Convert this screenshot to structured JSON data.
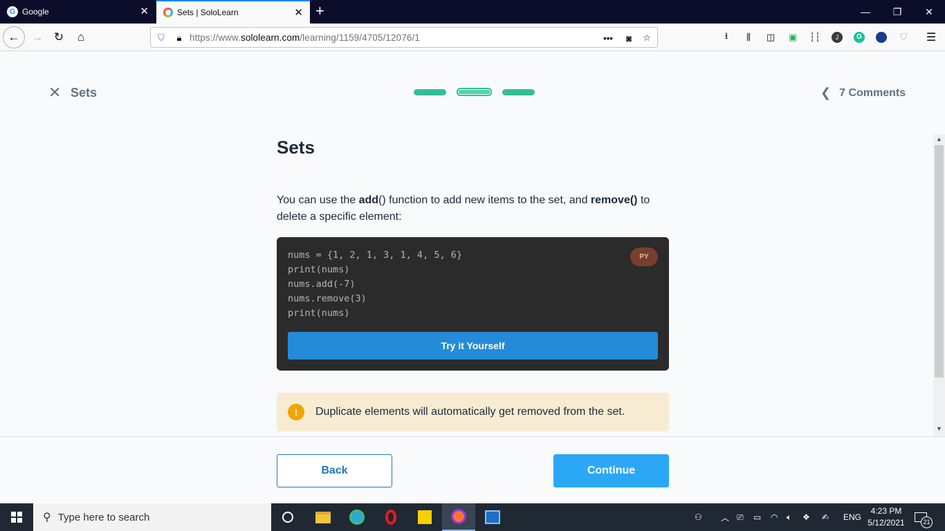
{
  "browser": {
    "tabs": [
      {
        "title": "Google"
      },
      {
        "title": "Sets | SoloLearn"
      }
    ],
    "url_prefix": "https://www.",
    "url_domain": "sololearn.com",
    "url_path": "/learning/1159/4705/12076/1"
  },
  "lesson": {
    "header_title": "Sets",
    "progress_steps": 3,
    "active_step": 2,
    "comments_label": "7 Comments",
    "title": "Sets",
    "text_part1": "You can use the ",
    "text_bold1": "add",
    "text_part2": "() function to add new items to the set, and ",
    "text_bold2": "remove()",
    "text_part3": " to delete a specific element:",
    "code_lines": [
      "nums = {1, 2, 1, 3, 1, 4, 5, 6}",
      "print(nums)",
      "nums.add(-7)",
      "nums.remove(3)",
      "print(nums)"
    ],
    "code_lang": "PY",
    "try_button": "Try it Yourself",
    "note_text": "Duplicate elements will automatically get removed from the set.",
    "back_button": "Back",
    "continue_button": "Continue"
  },
  "taskbar": {
    "search_placeholder": "Type here to search",
    "lang": "ENG",
    "time": "4:23 PM",
    "date": "5/12/2021",
    "notification_count": "21"
  },
  "colors": {
    "accent": "#2aa8f6",
    "progress": "#35bd95",
    "code_bg": "#2b2b2b",
    "note_bg": "#f7ecd1",
    "warn": "#f0a500"
  }
}
